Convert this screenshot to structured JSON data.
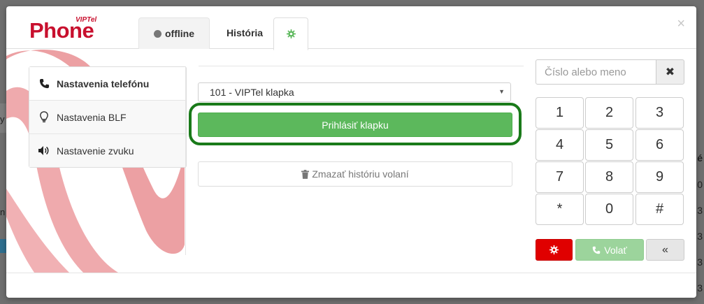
{
  "app": {
    "logo_text": "Phone",
    "logo_sup": "VIPTel",
    "brand_color": "#c8102e"
  },
  "tabs": {
    "status_label": "offline",
    "history_label": "História",
    "settings_icon": "gear-icon"
  },
  "close_label": "×",
  "sidebar": {
    "items": [
      {
        "label": "Nastavenia telefónu",
        "icon": "phone-icon",
        "active": true
      },
      {
        "label": "Nastavenia BLF",
        "icon": "lightbulb-icon",
        "active": false
      },
      {
        "label": "Nastavenie zvuku",
        "icon": "volume-icon",
        "active": false
      }
    ]
  },
  "phone_settings": {
    "extension_selected": "101 - VIPTel klapka",
    "login_button": "Prihlásiť klapku",
    "clear_history_button": "Zmazať históriu volaní"
  },
  "dialer": {
    "search_placeholder": "Číslo alebo meno",
    "clear_label": "✖",
    "keys": [
      "1",
      "2",
      "3",
      "4",
      "5",
      "6",
      "7",
      "8",
      "9",
      "*",
      "0",
      "#"
    ],
    "call_button": "Volať",
    "collapse_button": "«"
  },
  "background_fragments": {
    "right_values": [
      "é",
      "0",
      "3",
      "3",
      "3",
      "3"
    ],
    "left_values": [
      "y",
      "n"
    ]
  },
  "colors": {
    "success": "#5cb85c",
    "danger": "#e00000",
    "highlight": "#1a7a1a"
  }
}
